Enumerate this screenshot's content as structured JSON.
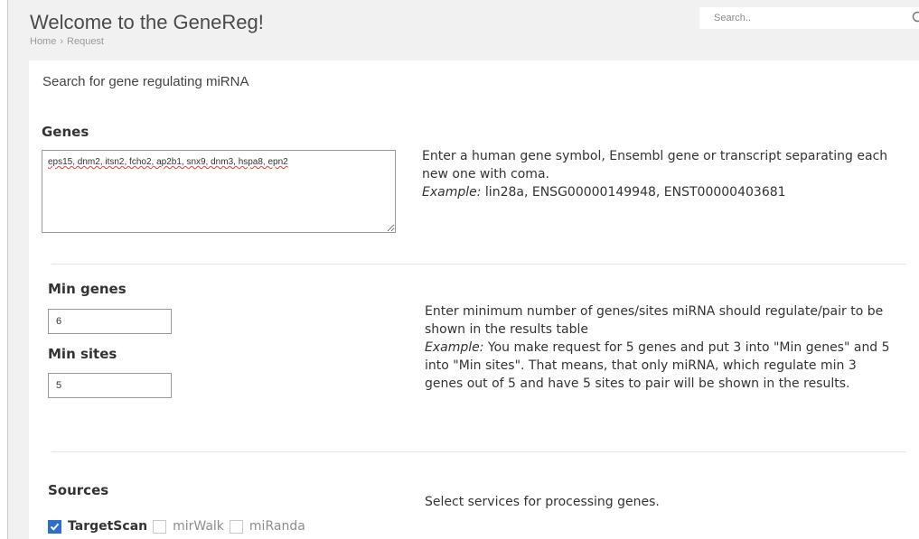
{
  "header": {
    "title": "Welcome to the GeneReg!",
    "breadcrumb": {
      "home": "Home",
      "separator": "›",
      "current": "Request"
    },
    "search": {
      "placeholder": "Search.."
    }
  },
  "form": {
    "title": "Search for gene regulating miRNA",
    "genes": {
      "label": "Genes",
      "value": "eps15, dnm2, itsn2, fcho2, ap2b1, snx9, dnm3, hspa8, epn2",
      "help_line1": "Enter a human gene symbol, Ensembl gene or transcript separating each",
      "help_line2": "new one with coma.",
      "example_label": "Example:",
      "example_text": " lin28a, ENSG00000149948, ENST00000403681"
    },
    "min_genes": {
      "label": "Min genes",
      "value": "6"
    },
    "min_sites": {
      "label": "Min sites",
      "value": "5"
    },
    "min_help": {
      "line1": "Enter minimum number of genes/sites miRNA should regulate/pair to be",
      "line2": "shown in the results table",
      "example_label": "Example:",
      "line3": " You make request for 5 genes and put 3 into \"Min genes\" and 5",
      "line4": "into \"Min sites\". That means, that only miRNA, which regulate min 3",
      "line5": "genes out of 5 and have 5 sites to pair will be shown in the results."
    },
    "sources": {
      "label": "Sources",
      "help": "Select services for processing genes.",
      "options": [
        {
          "label": "TargetScan",
          "checked": true
        },
        {
          "label": "mirWalk",
          "checked": false
        },
        {
          "label": "miRanda",
          "checked": false
        }
      ]
    }
  },
  "colors": {
    "accent": "#2f6fc9",
    "page_bg": "#f1f1f1",
    "card_bg": "#ffffff"
  }
}
